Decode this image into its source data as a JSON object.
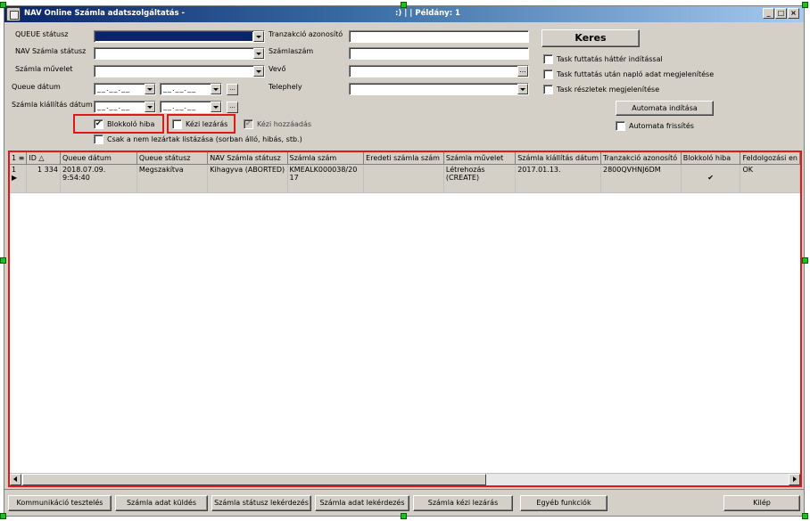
{
  "window": {
    "title": "NAV Online Számla adatszolgáltatás -",
    "title_right": ":) |  | Példány: 1",
    "controls": [
      "_",
      "□",
      "×"
    ]
  },
  "filters": {
    "queue_status_label": "QUEUE státusz",
    "nav_status_label": "NAV Számla státusz",
    "invoice_op_label": "Számla művelet",
    "queue_date_label": "Queue dátum",
    "issue_date_label": "Számla kiállítás dátum",
    "transaction_id_label": "Tranzakció azonosító",
    "invoice_no_label": "Számlaszám",
    "buyer_label": "Vevő",
    "site_label": "Telephely",
    "date_mask": "__.__.__",
    "ellipsis": "...",
    "blocking_error_label": "Blokkoló hiba",
    "manual_close_label": "Kézi lezárás",
    "manual_add_label": "Kézi hozzáadás",
    "only_unclosed_label": "Csak a nem lezártak listázása (sorban álló, hibás, stb.)"
  },
  "actions": {
    "search_label": "Keres",
    "task_bg_label": "Task futtatás háttér indítással",
    "task_log_label": "Task futtatás után napló adat megjelenítése",
    "task_details_label": "Task részletek megjelenítése",
    "auto_start_label": "Automata indítása",
    "auto_refresh_label": "Automata frissítés"
  },
  "grid": {
    "columns": [
      "1 ≡",
      "ID  △",
      "Queue dátum",
      "Queue státusz",
      "NAV Számla státusz",
      "Számla szám",
      "Eredeti számla szám",
      "Számla művelet",
      "Számla kiállítás dátum",
      "Tranzakció azonosító",
      "Blokkoló hiba",
      "Feldolgozási en"
    ],
    "rows": [
      {
        "num": "1",
        "id": "1 334",
        "queue_date": "2018.07.09. 9:54:40",
        "queue_status": "Megszakítva",
        "nav_status": "Kihagyva (ABORTED)",
        "invoice_no": "KMEALK000038/2017",
        "original_no": "",
        "operation": "Létrehozás (CREATE)",
        "issue_date": "2017.01.13.",
        "transaction_id": "2800QVHNJ6DM",
        "blocking": "✔",
        "processing": "OK"
      }
    ]
  },
  "bottom": {
    "comm_test": "Kommunikáció tesztelés",
    "send_data": "Számla adat küldés",
    "status_query": "Számla státusz lekérdezés",
    "data_query": "Számla adat lekérdezés",
    "manual_close": "Számla kézi lezárás",
    "other": "Egyéb funkciók",
    "exit": "Kilép"
  },
  "colors": {
    "highlight": "#e01818",
    "face": "#d4d0c8",
    "title_start": "#0a246a",
    "handle": "#19c319"
  }
}
